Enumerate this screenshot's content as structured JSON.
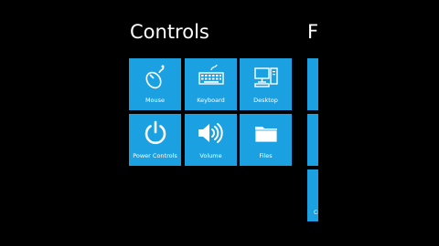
{
  "start": {
    "group_title": "Controls",
    "next_group_title_partial": "F"
  },
  "tiles": [
    {
      "label": "Mouse",
      "icon": "mouse-icon"
    },
    {
      "label": "Keyboard",
      "icon": "keyboard-icon"
    },
    {
      "label": "Desktop",
      "icon": "desktop-icon"
    },
    {
      "label": "Power Controls",
      "icon": "power-icon"
    },
    {
      "label": "Volume",
      "icon": "volume-icon"
    },
    {
      "label": "Files",
      "icon": "folder-icon"
    }
  ],
  "next_group_tiles_partial": [
    {
      "label": ""
    },
    {
      "label": ""
    },
    {
      "label": "Cu"
    }
  ],
  "colors": {
    "background": "#000000",
    "tile_accent": "#1ba1e2",
    "text": "#ffffff"
  }
}
